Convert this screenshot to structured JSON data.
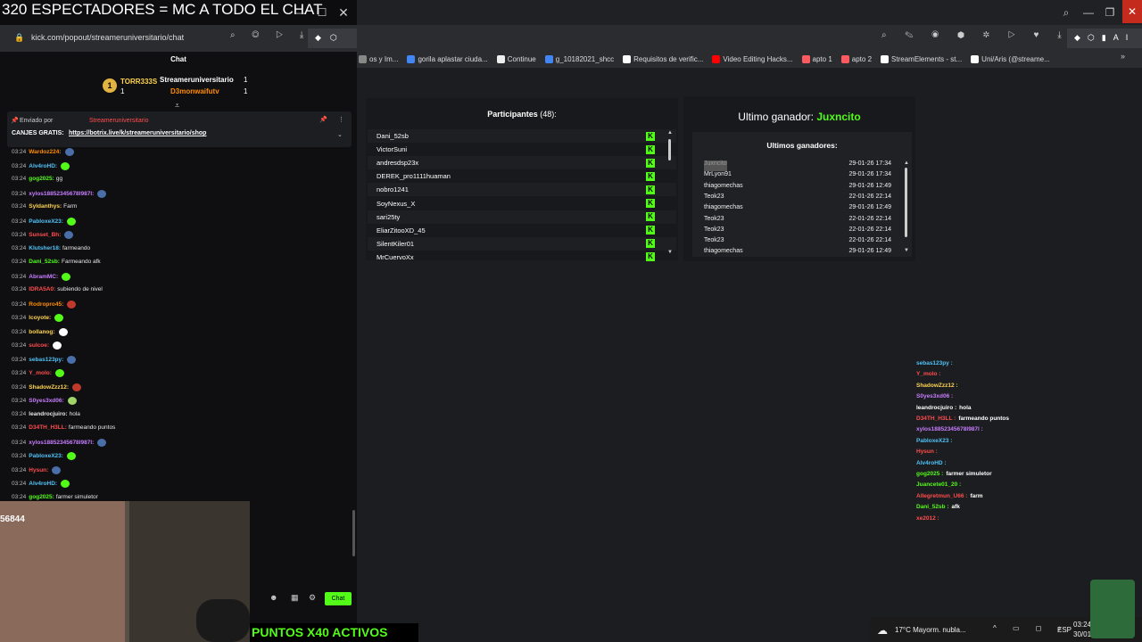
{
  "window": {
    "title": "320 ESPECTADORES = MC A TODO EL CHAT"
  },
  "popup": {
    "url": "kick.com/popout/streameruniversitario/chat",
    "chat_header": "Chat"
  },
  "leaderboard": {
    "first_name": "TORR333S",
    "first_count": "1",
    "second_name": "Streameruniversitario",
    "second_count": "1",
    "third_name": "D3monwaifutv",
    "third_count": "1"
  },
  "pinned": {
    "sent_by_label": "Enviado por",
    "sender": "Streameruniversitario",
    "text_prefix": "CANJES GRATIS:",
    "link": "https://botrix.live/k/streameruniversitario/shop"
  },
  "chat_messages": [
    {
      "time": "03:24",
      "user": "Wardoz224:",
      "text": "",
      "color": "#ff8c00",
      "emote": "#4a6ea8"
    },
    {
      "time": "03:24",
      "user": "Alv4roHD:",
      "text": "",
      "color": "#4fc3f7",
      "emote": "#53fc18"
    },
    {
      "time": "03:24",
      "user": "gog2025:",
      "text": "gg",
      "color": "#53fc18",
      "emote": ""
    },
    {
      "time": "03:24",
      "user": "xylos18852345678l987l:",
      "text": "",
      "color": "#c77dff",
      "emote": "#4a6ea8"
    },
    {
      "time": "03:24",
      "user": "Syldanthys:",
      "text": "Farm",
      "color": "#ffd54f",
      "emote": ""
    },
    {
      "time": "03:24",
      "user": "PabloxeX23:",
      "text": "",
      "color": "#4fc3f7",
      "emote": "#53fc18"
    },
    {
      "time": "03:24",
      "user": "Sunset_Bh:",
      "text": "",
      "color": "#ff4d4d",
      "emote": "#4a6ea8"
    },
    {
      "time": "03:24",
      "user": "Klutsher18:",
      "text": "farmeando",
      "color": "#4fc3f7",
      "emote": ""
    },
    {
      "time": "03:24",
      "user": "Dani_52sb:",
      "text": "Farmeando afk",
      "color": "#53fc18",
      "emote": ""
    },
    {
      "time": "03:24",
      "user": "AbramMC:",
      "text": "",
      "color": "#c77dff",
      "emote": "#53fc18"
    },
    {
      "time": "03:24",
      "user": "IDRA5A0:",
      "text": "subiendo de nivel",
      "color": "#ff4d4d",
      "emote": ""
    },
    {
      "time": "03:24",
      "user": "Rodropro45:",
      "text": "",
      "color": "#ff8c00",
      "emote": "#c0392b"
    },
    {
      "time": "03:24",
      "user": "lcoyote:",
      "text": "",
      "color": "#ffd54f",
      "emote": "#53fc18"
    },
    {
      "time": "03:24",
      "user": "bollanog:",
      "text": "",
      "color": "#ffd54f",
      "emote": "#ffffff"
    },
    {
      "time": "03:24",
      "user": "sulcoe:",
      "text": "",
      "color": "#ff4d4d",
      "emote": "#ffffff"
    },
    {
      "time": "03:24",
      "user": "sebas123py:",
      "text": "",
      "color": "#4fc3f7",
      "emote": "#4a6ea8"
    },
    {
      "time": "03:24",
      "user": "Y_molo:",
      "text": "",
      "color": "#ff4d4d",
      "emote": "#53fc18"
    },
    {
      "time": "03:24",
      "user": "ShadowZzz12:",
      "text": "",
      "color": "#ffd54f",
      "emote": "#c0392b"
    },
    {
      "time": "03:24",
      "user": "S0yes3xd06:",
      "text": "",
      "color": "#c77dff",
      "emote": "#a0d468"
    },
    {
      "time": "03:24",
      "user": "leandrocjuiro:",
      "text": "hola",
      "color": "#e6e6e6",
      "emote": ""
    },
    {
      "time": "03:24",
      "user": "D34TH_H3LL:",
      "text": "farmeando puntos",
      "color": "#ff4d4d",
      "emote": ""
    },
    {
      "time": "03:24",
      "user": "xylos18852345678l987l:",
      "text": "",
      "color": "#c77dff",
      "emote": "#4a6ea8"
    },
    {
      "time": "03:24",
      "user": "PabloxeX23:",
      "text": "",
      "color": "#4fc3f7",
      "emote": "#53fc18"
    },
    {
      "time": "03:24",
      "user": "Hysun:",
      "text": "",
      "color": "#ff4d4d",
      "emote": "#4a6ea8"
    },
    {
      "time": "03:24",
      "user": "Alv4roHD:",
      "text": "",
      "color": "#4fc3f7",
      "emote": "#53fc18"
    },
    {
      "time": "03:24",
      "user": "gog2025:",
      "text": "farmer simuletor",
      "color": "#53fc18",
      "emote": ""
    }
  ],
  "viewer_count_overlay": "56844",
  "chat_send_label": "Chat",
  "puntos_banner": "PUNTOS X40 ACTIVOS",
  "bookmarks": [
    {
      "label": "os y Im...",
      "color": "#888"
    },
    {
      "label": "gorila aplastar ciuda...",
      "color": "#4285f4"
    },
    {
      "label": "Continue",
      "color": "#eeeeee"
    },
    {
      "label": "g_10182021_shcc",
      "color": "#4285f4"
    },
    {
      "label": "Requisitos de verific...",
      "color": "#ffffff"
    },
    {
      "label": "Video Editing Hacks...",
      "color": "#ff0000"
    },
    {
      "label": "apto 1",
      "color": "#ff5a5f"
    },
    {
      "label": "apto 2",
      "color": "#ff5a5f"
    },
    {
      "label": "StreamElements - st...",
      "color": "#ffffff"
    },
    {
      "label": "Uni/Aris (@streame...",
      "color": "#ffffff"
    }
  ],
  "participants": {
    "title": "Participantes",
    "count": "(48):",
    "list": [
      "Dani_52sb",
      "VictorSuni",
      "andresdsp23x",
      "DEREK_pro1111huaman",
      "nobro1241",
      "SoyNexus_X",
      "sari25ty",
      "EliarZitooXD_45",
      "SilentKiler01",
      "MrCuervoXx"
    ]
  },
  "winners": {
    "last_label": "Ultimo ganador:",
    "last_name": "Juxncito",
    "list_title": "Ultimos ganadores:",
    "rows": [
      {
        "name": "Juxncito",
        "date": "29-01-26 17:34"
      },
      {
        "name": "MrLyon91",
        "date": "29-01-26 17:34"
      },
      {
        "name": "thiagomechas",
        "date": "29-01-26 12:49"
      },
      {
        "name": "Teok23",
        "date": "22-01-26 22:14"
      },
      {
        "name": "thiagomechas",
        "date": "29-01-26 12:49"
      },
      {
        "name": "Teok23",
        "date": "22-01-26 22:14"
      },
      {
        "name": "Teok23",
        "date": "22-01-26 22:14"
      },
      {
        "name": "Teok23",
        "date": "22-01-26 22:14"
      },
      {
        "name": "thiagomechas",
        "date": "29-01-26 12:49"
      }
    ]
  },
  "overlay_chat": [
    {
      "user": "sebas123py :",
      "text": "",
      "color": "#4fc3f7"
    },
    {
      "user": "Y_molo :",
      "text": "",
      "color": "#ff4d4d"
    },
    {
      "user": "ShadowZzz12 :",
      "text": "",
      "color": "#ffd54f"
    },
    {
      "user": "S0yes3xd06 :",
      "text": "",
      "color": "#c77dff"
    },
    {
      "user": "leandrocjuiro :",
      "text": "hola",
      "color": "#ffffff"
    },
    {
      "user": "D34TH_H3LL :",
      "text": "farmeando puntos",
      "color": "#ff4d4d"
    },
    {
      "user": "xylos18852345678l987l :",
      "text": "",
      "color": "#c77dff"
    },
    {
      "user": "PabloxeX23 :",
      "text": "",
      "color": "#4fc3f7"
    },
    {
      "user": "Hysun :",
      "text": "",
      "color": "#ff4d4d"
    },
    {
      "user": "Alv4roHD :",
      "text": "",
      "color": "#4fc3f7"
    },
    {
      "user": "gog2025 :",
      "text": "farmer simuletor",
      "color": "#53fc18"
    },
    {
      "user": "Juancete01_20 :",
      "text": "",
      "color": "#53fc18"
    },
    {
      "user": "Allegretmun_U66 :",
      "text": "farm",
      "color": "#ff4d4d"
    },
    {
      "user": "Dani_52sb :",
      "text": "afk",
      "color": "#53fc18"
    },
    {
      "user": "xe2012 :",
      "text": "",
      "color": "#ff4d4d"
    }
  ],
  "taskbar": {
    "weather": "17°C  Mayorm. nubla...",
    "lang": "ESP",
    "time": "03:24",
    "date": "30/01/"
  }
}
